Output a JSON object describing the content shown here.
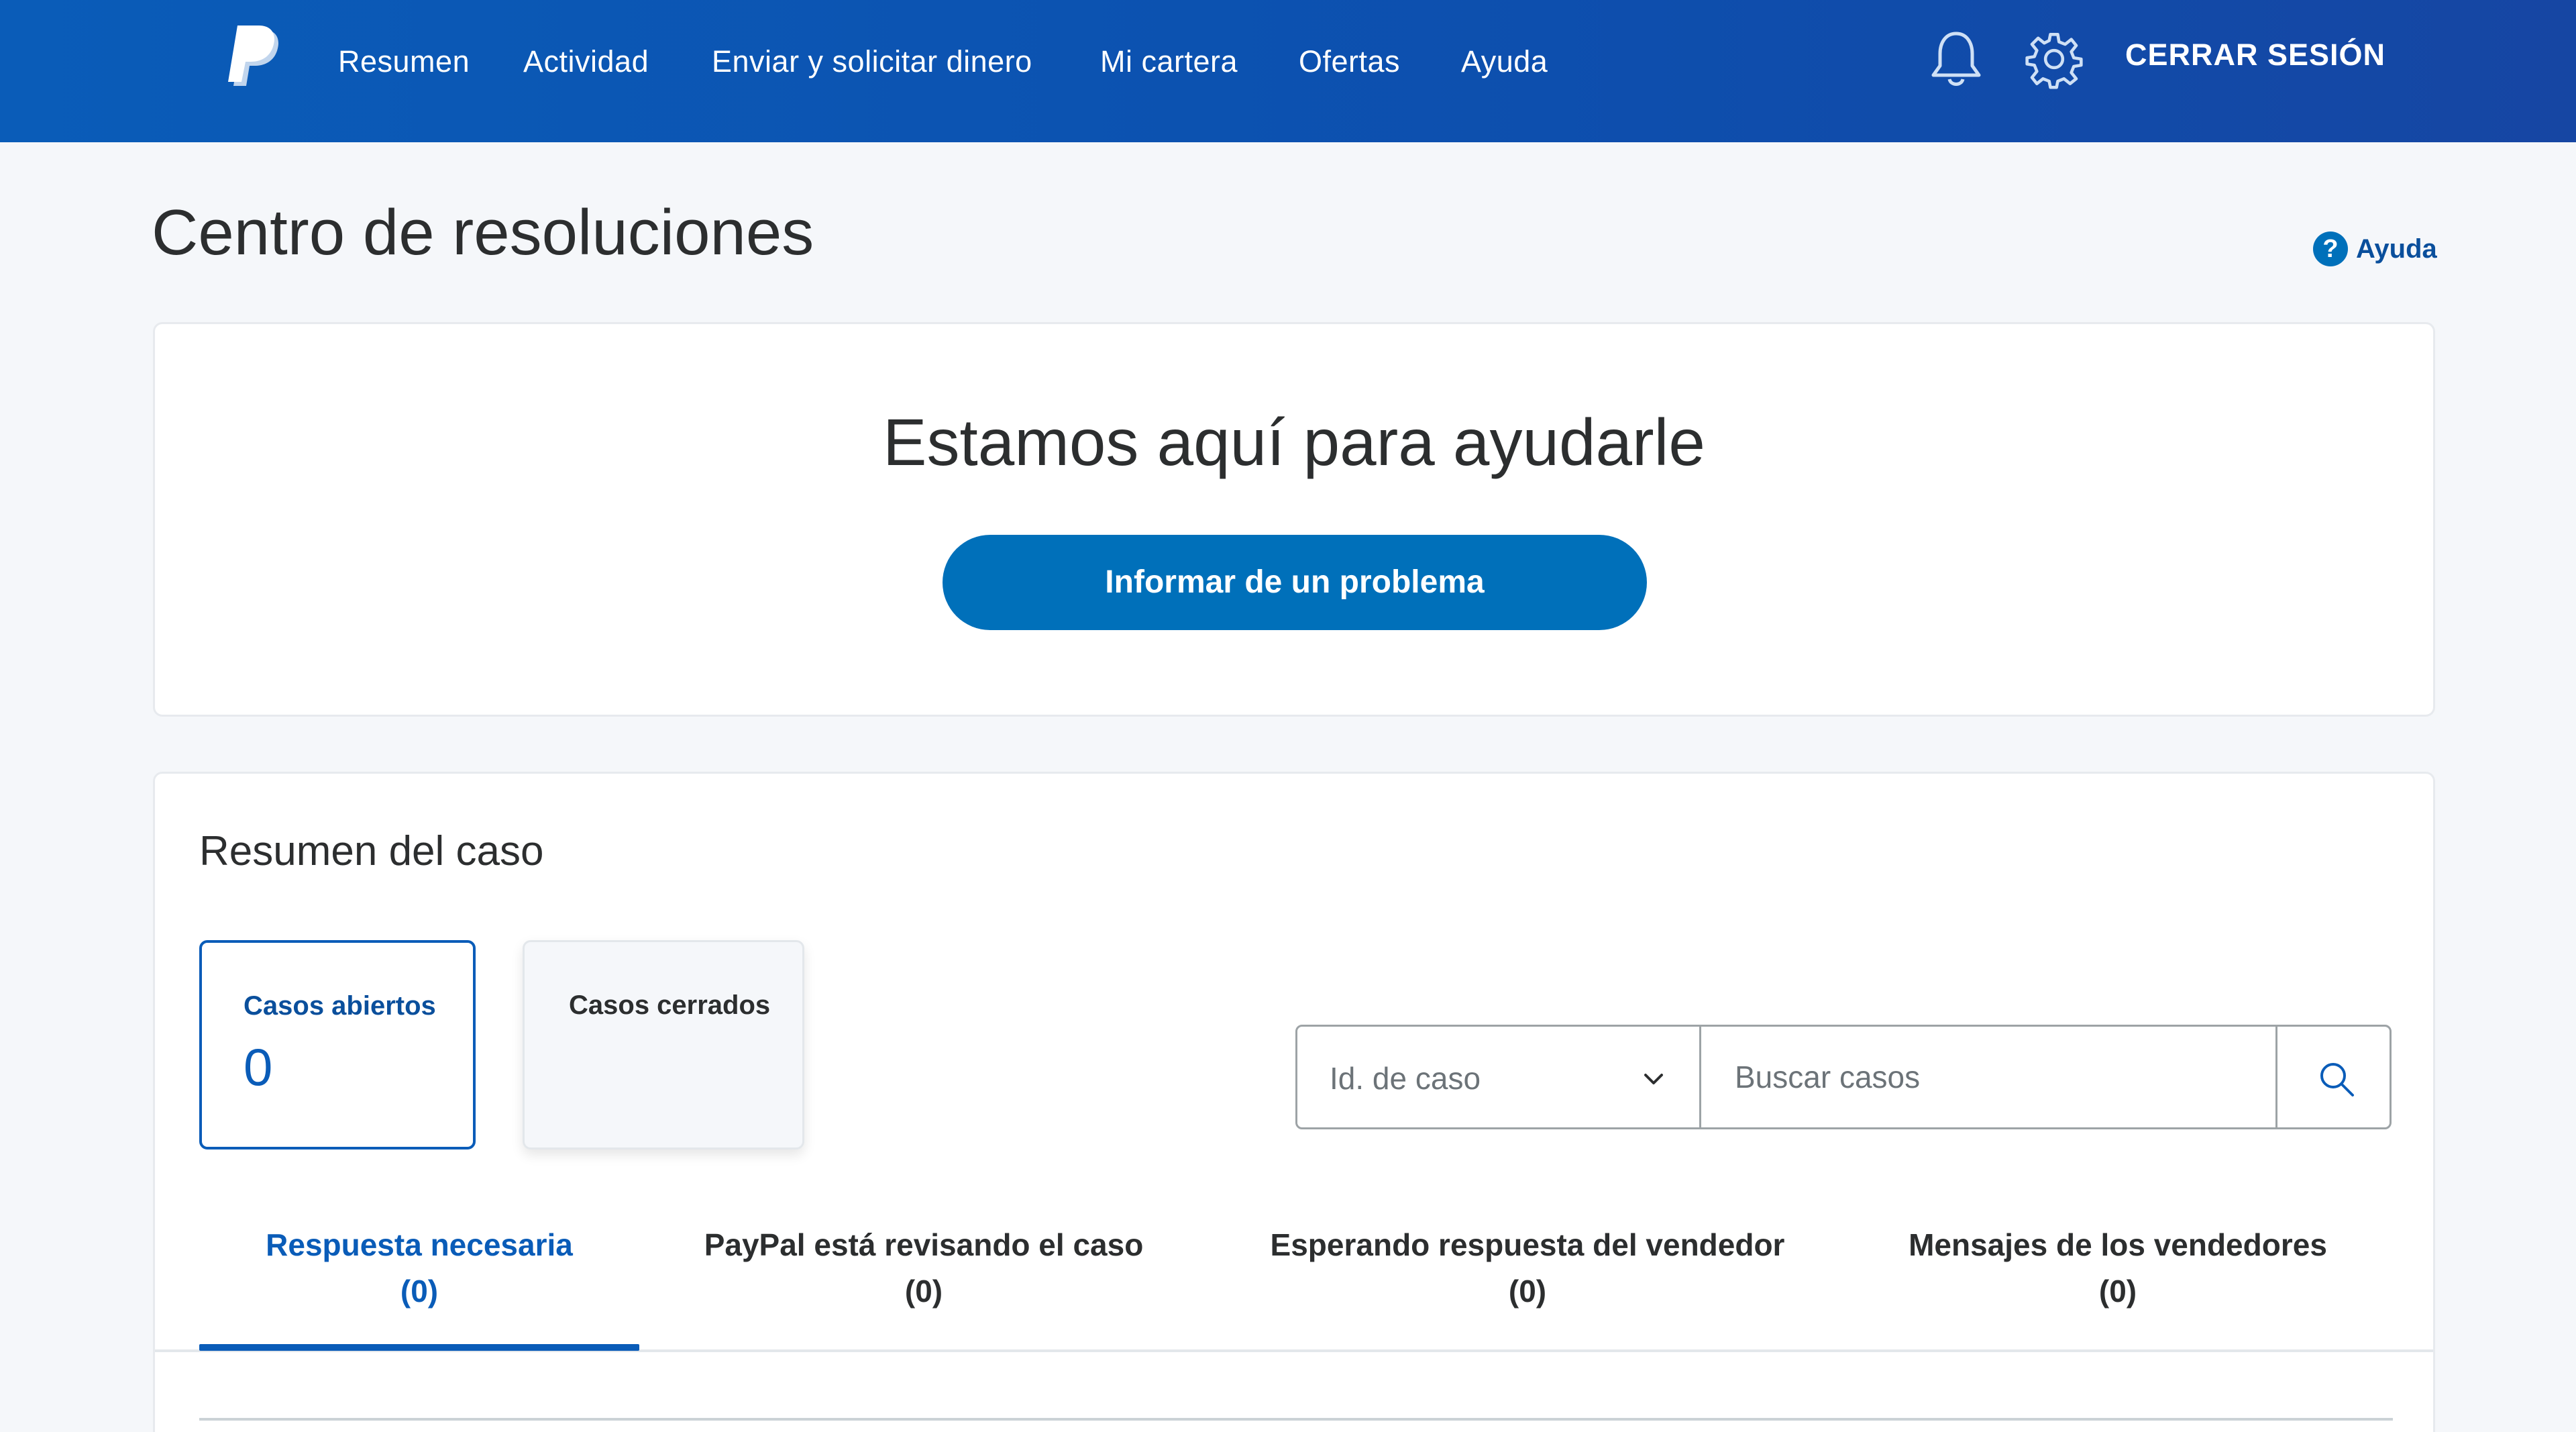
{
  "nav": {
    "items": [
      {
        "label": "Resumen"
      },
      {
        "label": "Actividad"
      },
      {
        "label": "Enviar y solicitar dinero"
      },
      {
        "label": "Mi cartera"
      },
      {
        "label": "Ofertas"
      },
      {
        "label": "Ayuda"
      }
    ],
    "logout_label": "CERRAR SESIÓN",
    "icons": [
      "paypal-logo",
      "bell-icon",
      "gear-icon"
    ]
  },
  "page": {
    "title": "Centro de resoluciones",
    "help_label": "Ayuda",
    "help_icon_glyph": "?"
  },
  "hero": {
    "heading": "Estamos aquí para ayudarle",
    "button_label": "Informar de un problema"
  },
  "case_summary": {
    "title": "Resumen del caso",
    "open": {
      "label": "Casos abiertos",
      "count": "0"
    },
    "closed": {
      "label": "Casos cerrados"
    }
  },
  "search": {
    "filter_selected": "Id. de caso",
    "placeholder": "Buscar casos"
  },
  "tabs": [
    {
      "label": "Respuesta necesaria",
      "count": "(0)",
      "active": true
    },
    {
      "label": "PayPal está revisando el caso",
      "count": "(0)",
      "active": false
    },
    {
      "label": "Esperando respuesta del vendedor",
      "count": "(0)",
      "active": false
    },
    {
      "label": "Mensajes de los vendedores",
      "count": "(0)",
      "active": false
    }
  ],
  "colors": {
    "nav_start": "#0a5cb8",
    "nav_end": "#1646a3",
    "accent": "#0070ba",
    "active_tab": "#0a5cb8",
    "page_bg": "#f5f7fa"
  }
}
